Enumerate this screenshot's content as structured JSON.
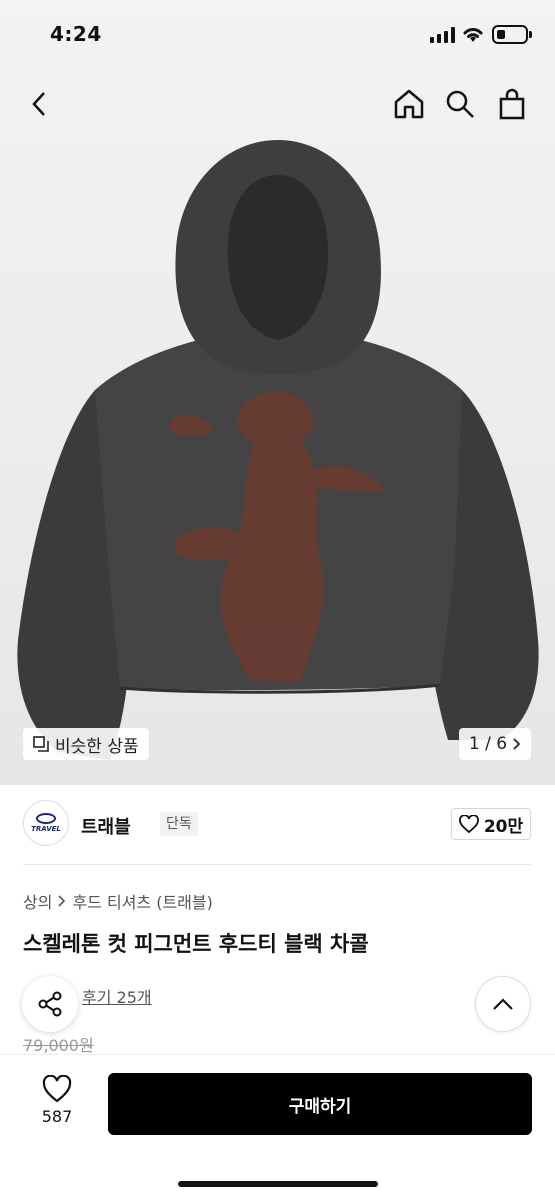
{
  "status_bar": {
    "time": "4:24"
  },
  "nav": {
    "back_icon": "chevron-left-icon",
    "home_icon": "home-icon",
    "search_icon": "search-icon",
    "bag_icon": "shopping-bag-icon"
  },
  "image": {
    "similar_label": "비슷한 상품",
    "page_indicator": "1 / 6"
  },
  "brand": {
    "logo_text": "TRAVEL",
    "name": "트래블",
    "tag": "단독",
    "likes": "20만"
  },
  "product": {
    "breadcrumb": [
      "상의",
      "후드 티셔츠 (트래블)"
    ],
    "title": "스켈레톤 컷 피그먼트 후드티 블랙 차콜",
    "review_link": "후기 25개",
    "price": "79,000원"
  },
  "bottom_bar": {
    "wish_count": "587",
    "buy_label": "구매하기"
  },
  "colors": {
    "hoodie": "#3e3f3e",
    "print": "#6b3a30",
    "buy_button": "#000000"
  }
}
